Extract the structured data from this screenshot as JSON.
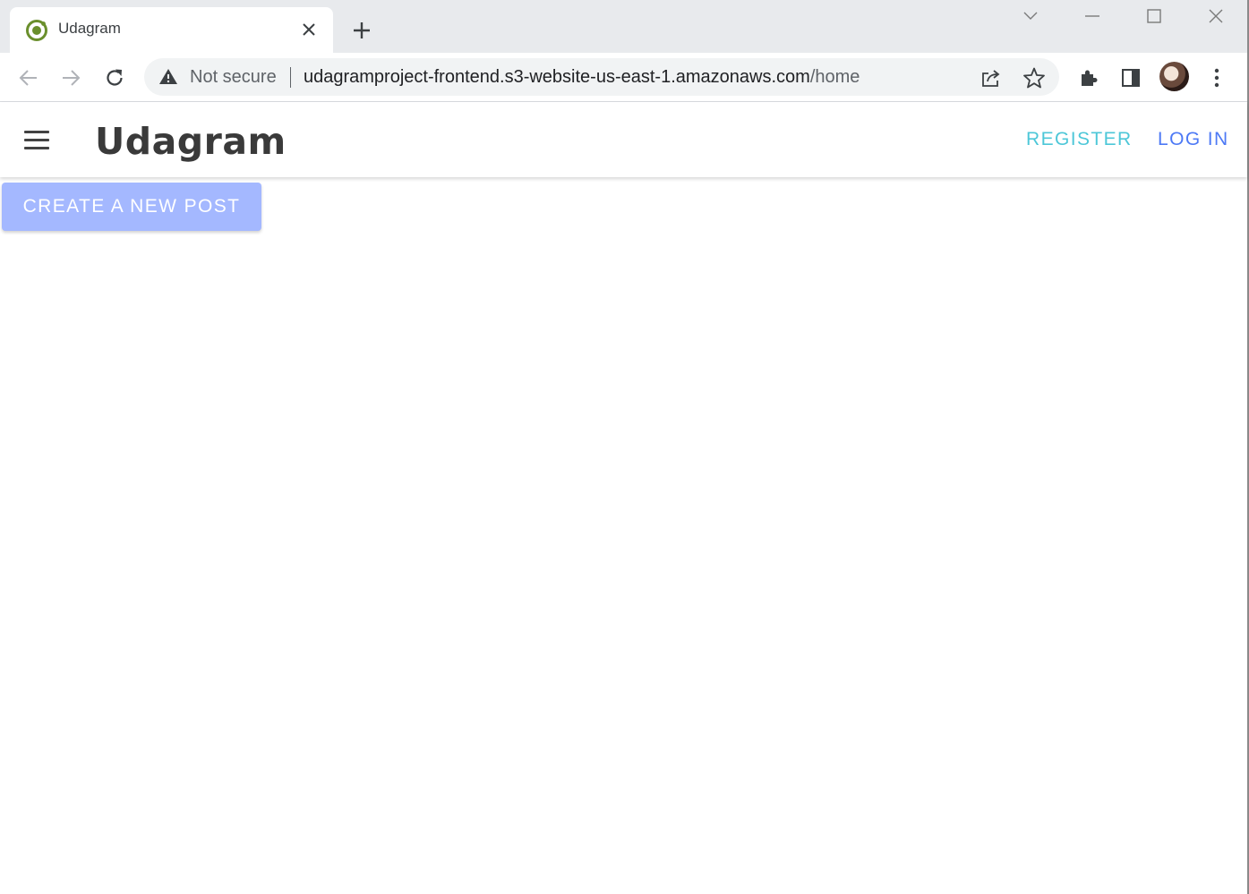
{
  "browser": {
    "tab": {
      "title": "Udagram",
      "favicon": "ionic-logo-icon"
    },
    "address_bar": {
      "security_label": "Not secure",
      "url_host": "udagramproject-frontend.s3-website-us-east-1.amazonaws.com",
      "url_path": "/home"
    },
    "icons": [
      "back-icon",
      "forward-icon",
      "reload-icon",
      "warning-icon",
      "share-icon",
      "star-icon",
      "extensions-icon",
      "side-panel-icon",
      "profile-avatar",
      "more-icon",
      "tab-search-icon",
      "minimize-icon",
      "maximize-icon",
      "close-icon"
    ]
  },
  "app": {
    "brand": "Udagram",
    "nav": {
      "register": "REGISTER",
      "login": "LOG IN"
    },
    "create_post_label": "CREATE A NEW POST"
  },
  "colors": {
    "register": "#4dc7d8",
    "login": "#4d79f5",
    "create_button": "#a4b8ff"
  }
}
